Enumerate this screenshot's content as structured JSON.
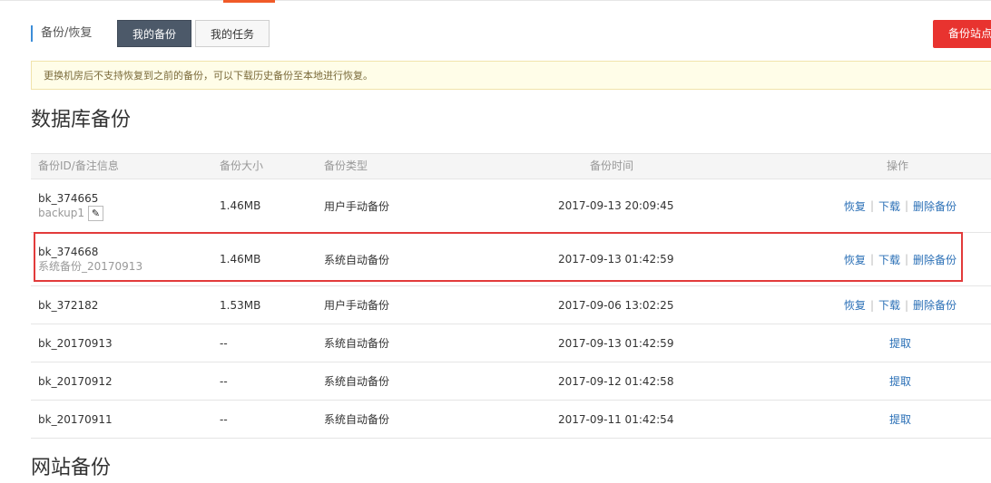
{
  "header": {
    "section_label": "备份/恢复",
    "tabs": [
      {
        "label": "我的备份",
        "active": true
      },
      {
        "label": "我的任务",
        "active": false
      }
    ],
    "site_backup_button": "备份站点"
  },
  "notice": "更换机房后不支持恢复到之前的备份，可以下载历史备份至本地进行恢复。",
  "db_section": {
    "title": "数据库备份",
    "columns": [
      "备份ID/备注信息",
      "备份大小",
      "备份类型",
      "备份时间",
      "操作"
    ],
    "rows": [
      {
        "id": "bk_374665",
        "note": "backup1",
        "editable": true,
        "size": "1.46MB",
        "type": "用户手动备份",
        "time": "2017-09-13 20:09:45",
        "actions": [
          "恢复",
          "下载",
          "删除备份"
        ]
      },
      {
        "id": "bk_374668",
        "note": "系统备份_20170913",
        "editable": false,
        "size": "1.46MB",
        "type": "系统自动备份",
        "time": "2017-09-13 01:42:59",
        "actions": [
          "恢复",
          "下载",
          "删除备份"
        ],
        "highlighted": true
      },
      {
        "id": "bk_372182",
        "note": "",
        "editable": false,
        "size": "1.53MB",
        "type": "用户手动备份",
        "time": "2017-09-06 13:02:25",
        "actions": [
          "恢复",
          "下载",
          "删除备份"
        ]
      },
      {
        "id": "bk_20170913",
        "note": "",
        "editable": false,
        "size": "--",
        "type": "系统自动备份",
        "time": "2017-09-13 01:42:59",
        "actions": [
          "提取"
        ]
      },
      {
        "id": "bk_20170912",
        "note": "",
        "editable": false,
        "size": "--",
        "type": "系统自动备份",
        "time": "2017-09-12 01:42:58",
        "actions": [
          "提取"
        ]
      },
      {
        "id": "bk_20170911",
        "note": "",
        "editable": false,
        "size": "--",
        "type": "系统自动备份",
        "time": "2017-09-11 01:42:54",
        "actions": [
          "提取"
        ]
      }
    ]
  },
  "site_section": {
    "title": "网站备份"
  },
  "icons": {
    "edit": "pencil-icon"
  },
  "colors": {
    "accent": "#3c8dd8",
    "danger": "#e8332f",
    "link": "#2a6fb6",
    "highlight": "#e23b3b",
    "tab_active": "#4c5969"
  }
}
